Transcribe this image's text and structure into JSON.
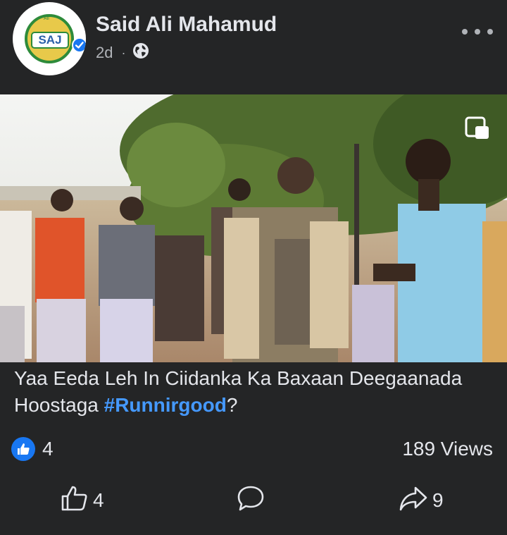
{
  "post": {
    "author": "Said Ali Mahamud",
    "time": "2d",
    "separator": "·",
    "logo_text": "SAJ",
    "logo_arc_text": "Ali",
    "caption_text": "Yaa Eeda Leh In Ciidanka Ka Baxaan Deegaanada Hoostaga ",
    "hashtag": "#Runnirgood",
    "caption_end": "?",
    "reaction_count": "4",
    "views": "189 Views"
  },
  "actions": {
    "like_count": "4",
    "share_count": "9"
  },
  "colors": {
    "background": "#242526",
    "text": "#e4e6eb",
    "secondary_text": "#b0b3b8",
    "hashtag": "#4599ff",
    "like_blue": "#1877f2"
  },
  "icons": [
    "globe-icon",
    "more-icon",
    "picture-in-picture-icon",
    "like-reaction-icon",
    "thumbs-up-icon",
    "comment-icon",
    "share-icon",
    "verified-icon"
  ]
}
